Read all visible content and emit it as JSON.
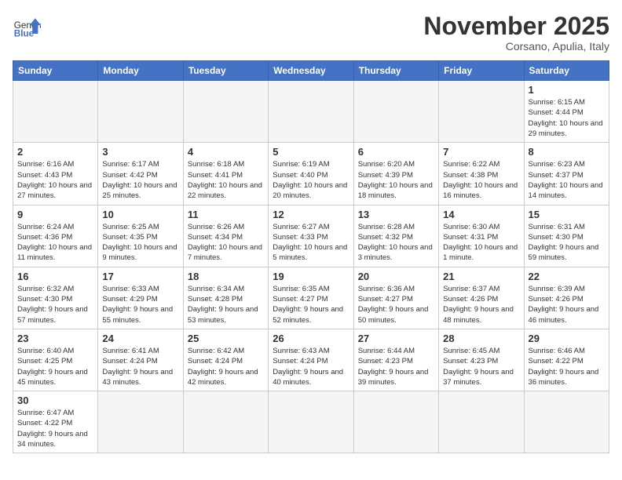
{
  "header": {
    "logo_general": "General",
    "logo_blue": "Blue",
    "month_title": "November 2025",
    "location": "Corsano, Apulia, Italy"
  },
  "weekdays": [
    "Sunday",
    "Monday",
    "Tuesday",
    "Wednesday",
    "Thursday",
    "Friday",
    "Saturday"
  ],
  "days": {
    "1": {
      "sunrise": "6:15 AM",
      "sunset": "4:44 PM",
      "daylight": "10 hours and 29 minutes."
    },
    "2": {
      "sunrise": "6:16 AM",
      "sunset": "4:43 PM",
      "daylight": "10 hours and 27 minutes."
    },
    "3": {
      "sunrise": "6:17 AM",
      "sunset": "4:42 PM",
      "daylight": "10 hours and 25 minutes."
    },
    "4": {
      "sunrise": "6:18 AM",
      "sunset": "4:41 PM",
      "daylight": "10 hours and 22 minutes."
    },
    "5": {
      "sunrise": "6:19 AM",
      "sunset": "4:40 PM",
      "daylight": "10 hours and 20 minutes."
    },
    "6": {
      "sunrise": "6:20 AM",
      "sunset": "4:39 PM",
      "daylight": "10 hours and 18 minutes."
    },
    "7": {
      "sunrise": "6:22 AM",
      "sunset": "4:38 PM",
      "daylight": "10 hours and 16 minutes."
    },
    "8": {
      "sunrise": "6:23 AM",
      "sunset": "4:37 PM",
      "daylight": "10 hours and 14 minutes."
    },
    "9": {
      "sunrise": "6:24 AM",
      "sunset": "4:36 PM",
      "daylight": "10 hours and 11 minutes."
    },
    "10": {
      "sunrise": "6:25 AM",
      "sunset": "4:35 PM",
      "daylight": "10 hours and 9 minutes."
    },
    "11": {
      "sunrise": "6:26 AM",
      "sunset": "4:34 PM",
      "daylight": "10 hours and 7 minutes."
    },
    "12": {
      "sunrise": "6:27 AM",
      "sunset": "4:33 PM",
      "daylight": "10 hours and 5 minutes."
    },
    "13": {
      "sunrise": "6:28 AM",
      "sunset": "4:32 PM",
      "daylight": "10 hours and 3 minutes."
    },
    "14": {
      "sunrise": "6:30 AM",
      "sunset": "4:31 PM",
      "daylight": "10 hours and 1 minute."
    },
    "15": {
      "sunrise": "6:31 AM",
      "sunset": "4:30 PM",
      "daylight": "9 hours and 59 minutes."
    },
    "16": {
      "sunrise": "6:32 AM",
      "sunset": "4:30 PM",
      "daylight": "9 hours and 57 minutes."
    },
    "17": {
      "sunrise": "6:33 AM",
      "sunset": "4:29 PM",
      "daylight": "9 hours and 55 minutes."
    },
    "18": {
      "sunrise": "6:34 AM",
      "sunset": "4:28 PM",
      "daylight": "9 hours and 53 minutes."
    },
    "19": {
      "sunrise": "6:35 AM",
      "sunset": "4:27 PM",
      "daylight": "9 hours and 52 minutes."
    },
    "20": {
      "sunrise": "6:36 AM",
      "sunset": "4:27 PM",
      "daylight": "9 hours and 50 minutes."
    },
    "21": {
      "sunrise": "6:37 AM",
      "sunset": "4:26 PM",
      "daylight": "9 hours and 48 minutes."
    },
    "22": {
      "sunrise": "6:39 AM",
      "sunset": "4:26 PM",
      "daylight": "9 hours and 46 minutes."
    },
    "23": {
      "sunrise": "6:40 AM",
      "sunset": "4:25 PM",
      "daylight": "9 hours and 45 minutes."
    },
    "24": {
      "sunrise": "6:41 AM",
      "sunset": "4:24 PM",
      "daylight": "9 hours and 43 minutes."
    },
    "25": {
      "sunrise": "6:42 AM",
      "sunset": "4:24 PM",
      "daylight": "9 hours and 42 minutes."
    },
    "26": {
      "sunrise": "6:43 AM",
      "sunset": "4:24 PM",
      "daylight": "9 hours and 40 minutes."
    },
    "27": {
      "sunrise": "6:44 AM",
      "sunset": "4:23 PM",
      "daylight": "9 hours and 39 minutes."
    },
    "28": {
      "sunrise": "6:45 AM",
      "sunset": "4:23 PM",
      "daylight": "9 hours and 37 minutes."
    },
    "29": {
      "sunrise": "6:46 AM",
      "sunset": "4:22 PM",
      "daylight": "9 hours and 36 minutes."
    },
    "30": {
      "sunrise": "6:47 AM",
      "sunset": "4:22 PM",
      "daylight": "9 hours and 34 minutes."
    }
  }
}
